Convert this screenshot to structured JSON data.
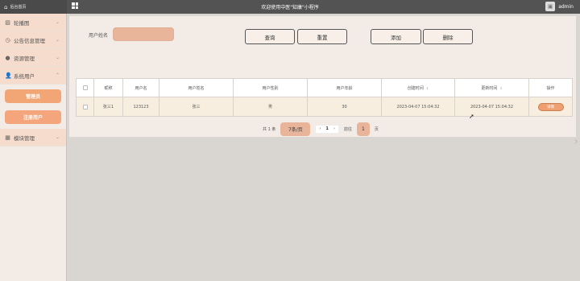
{
  "topbar": {
    "brand_title": "后台首页",
    "welcome": "欢迎使用中医\"知康\"小程序",
    "username": "admin"
  },
  "sidebar": {
    "items": [
      {
        "label": "轮播图",
        "icon": "image-icon"
      },
      {
        "label": "公告信息管理",
        "icon": "clock-icon"
      },
      {
        "label": "资源管理",
        "icon": "pin-icon"
      },
      {
        "label": "系统用户",
        "icon": "user-icon"
      },
      {
        "label": "模块管理",
        "icon": "grid-icon"
      }
    ],
    "sub_items": [
      {
        "label": "管理员"
      },
      {
        "label": "注册用户"
      }
    ]
  },
  "search": {
    "label": "用户姓名",
    "value": ""
  },
  "toolbar": {
    "query": "查询",
    "reset": "重置",
    "add": "添加",
    "delete": "删除"
  },
  "table": {
    "headers": [
      "",
      "昵称",
      "用户名",
      "用户姓名",
      "用户性别",
      "用户年龄",
      "创建时间",
      "更新时间",
      "操作"
    ],
    "rows": [
      {
        "nickname": "张三1",
        "username": "123123",
        "realname": "张三",
        "gender": "男",
        "age": "30",
        "created": "2023-04-07 15:04:32",
        "updated": "2023-04-07 15:04:32",
        "action": "详情"
      }
    ]
  },
  "pager": {
    "total_text": "共 1 条",
    "page_size": "7条/页",
    "current_page": "1",
    "goto_prefix": "前往",
    "goto_value": "1",
    "goto_suffix": "页"
  }
}
